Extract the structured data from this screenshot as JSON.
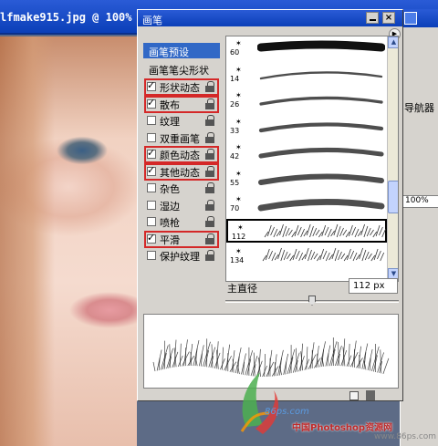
{
  "document": {
    "title": "lfmake915.jpg @ 100%"
  },
  "navigator": {
    "tab_label": "导航器",
    "zoom": "100%"
  },
  "palette": {
    "title": "画笔",
    "menu_icon": "triangle-right-icon",
    "preset_label": "画笔预设",
    "tip_shape_label": "画笔笔尖形状",
    "options": [
      {
        "label": "形状动态",
        "checked": true,
        "highlighted": true
      },
      {
        "label": "散布",
        "checked": true,
        "highlighted": true
      },
      {
        "label": "纹理",
        "checked": false,
        "highlighted": false
      },
      {
        "label": "双重画笔",
        "checked": false,
        "highlighted": false
      },
      {
        "label": "颜色动态",
        "checked": true,
        "highlighted": true
      },
      {
        "label": "其他动态",
        "checked": true,
        "highlighted": true
      },
      {
        "label": "杂色",
        "checked": false,
        "highlighted": false
      },
      {
        "label": "湿边",
        "checked": false,
        "highlighted": false
      },
      {
        "label": "喷枪",
        "checked": false,
        "highlighted": false
      },
      {
        "label": "平滑",
        "checked": true,
        "highlighted": true
      },
      {
        "label": "保护纹理",
        "checked": false,
        "highlighted": false
      }
    ],
    "brushes": [
      {
        "size": "60",
        "selected": false
      },
      {
        "size": "14",
        "selected": false
      },
      {
        "size": "26",
        "selected": false
      },
      {
        "size": "33",
        "selected": false
      },
      {
        "size": "42",
        "selected": false
      },
      {
        "size": "55",
        "selected": false
      },
      {
        "size": "70",
        "selected": false
      },
      {
        "size": "112",
        "selected": true
      },
      {
        "size": "134",
        "selected": false
      }
    ],
    "diameter_label": "主直径",
    "diameter_value": "112 px",
    "diameter_fraction": 0.5
  },
  "watermark": {
    "site": "86ps.com",
    "name": "中国Photoshop资源网",
    "url": "www.86ps.com"
  }
}
